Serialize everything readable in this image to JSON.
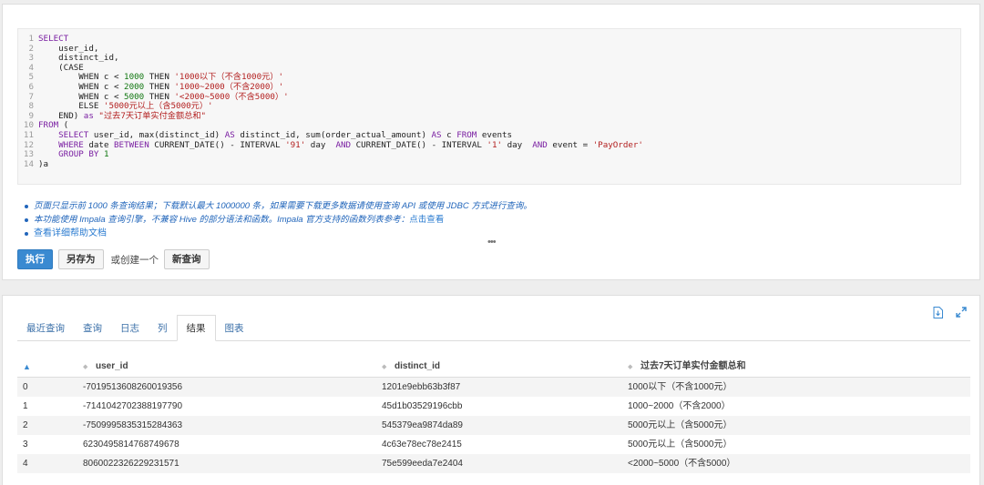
{
  "editor": {
    "lines": [
      {
        "n": "1",
        "parts": [
          {
            "t": "SELECT",
            "c": "kw"
          }
        ]
      },
      {
        "n": "2",
        "parts": [
          {
            "t": "    user_id,",
            "c": "plain"
          }
        ]
      },
      {
        "n": "3",
        "parts": [
          {
            "t": "    distinct_id,",
            "c": "plain"
          }
        ]
      },
      {
        "n": "4",
        "parts": [
          {
            "t": "    (CASE",
            "c": "plain"
          }
        ]
      },
      {
        "n": "5",
        "parts": [
          {
            "t": "        WHEN c < ",
            "c": "plain"
          },
          {
            "t": "1000",
            "c": "num"
          },
          {
            "t": " THEN ",
            "c": "plain"
          },
          {
            "t": "'1000以下（不含1000元）'",
            "c": "str"
          }
        ]
      },
      {
        "n": "6",
        "parts": [
          {
            "t": "        WHEN c < ",
            "c": "plain"
          },
          {
            "t": "2000",
            "c": "num"
          },
          {
            "t": " THEN ",
            "c": "plain"
          },
          {
            "t": "'1000~2000（不含2000）'",
            "c": "str"
          }
        ]
      },
      {
        "n": "7",
        "parts": [
          {
            "t": "        WHEN c < ",
            "c": "plain"
          },
          {
            "t": "5000",
            "c": "num"
          },
          {
            "t": " THEN ",
            "c": "plain"
          },
          {
            "t": "'<2000~5000（不含5000）'",
            "c": "str"
          }
        ]
      },
      {
        "n": "8",
        "parts": [
          {
            "t": "        ELSE ",
            "c": "plain"
          },
          {
            "t": "'5000元以上（含5000元）'",
            "c": "str"
          }
        ]
      },
      {
        "n": "9",
        "parts": [
          {
            "t": "    END) ",
            "c": "plain"
          },
          {
            "t": "as",
            "c": "kw"
          },
          {
            "t": " ",
            "c": "plain"
          },
          {
            "t": "\"过去7天订单实付金额总和\"",
            "c": "str"
          }
        ]
      },
      {
        "n": "10",
        "parts": [
          {
            "t": "FROM",
            "c": "kw"
          },
          {
            "t": " (",
            "c": "plain"
          }
        ]
      },
      {
        "n": "11",
        "parts": [
          {
            "t": "    ",
            "c": "plain"
          },
          {
            "t": "SELECT",
            "c": "kw"
          },
          {
            "t": " user_id, max(distinct_id) ",
            "c": "plain"
          },
          {
            "t": "AS",
            "c": "kw"
          },
          {
            "t": " distinct_id, sum(order_actual_amount) ",
            "c": "plain"
          },
          {
            "t": "AS",
            "c": "kw"
          },
          {
            "t": " c ",
            "c": "plain"
          },
          {
            "t": "FROM",
            "c": "kw"
          },
          {
            "t": " events",
            "c": "plain"
          }
        ]
      },
      {
        "n": "12",
        "parts": [
          {
            "t": "    ",
            "c": "plain"
          },
          {
            "t": "WHERE",
            "c": "kw"
          },
          {
            "t": " date ",
            "c": "plain"
          },
          {
            "t": "BETWEEN",
            "c": "kw"
          },
          {
            "t": " CURRENT_DATE() - INTERVAL ",
            "c": "plain"
          },
          {
            "t": "'91'",
            "c": "str"
          },
          {
            "t": " day  ",
            "c": "plain"
          },
          {
            "t": "AND",
            "c": "kw"
          },
          {
            "t": " CURRENT_DATE() - INTERVAL ",
            "c": "plain"
          },
          {
            "t": "'1'",
            "c": "str"
          },
          {
            "t": " day  ",
            "c": "plain"
          },
          {
            "t": "AND",
            "c": "kw"
          },
          {
            "t": " event = ",
            "c": "plain"
          },
          {
            "t": "'PayOrder'",
            "c": "str"
          }
        ]
      },
      {
        "n": "13",
        "parts": [
          {
            "t": "    ",
            "c": "plain"
          },
          {
            "t": "GROUP BY",
            "c": "kw"
          },
          {
            "t": " ",
            "c": "plain"
          },
          {
            "t": "1",
            "c": "num"
          }
        ]
      },
      {
        "n": "14",
        "parts": [
          {
            "t": ")a",
            "c": "plain"
          }
        ]
      }
    ]
  },
  "notes": {
    "line1": "页面只显示前 1000 条查询结果；下载默认最大 1000000 条，如果需要下载更多数据请使用查询 API 或使用 JDBC 方式进行查询。",
    "line2": "本功能使用 Impala 查询引擎，不兼容 Hive 的部分语法和函数。Impala 官方支持的函数列表参考：",
    "line2_link": "点击查看",
    "line3": "查看详细帮助文档"
  },
  "ellipsis": "•••",
  "actions": {
    "run": "执行",
    "save_as": "另存为",
    "or_create": "或创建一个",
    "new_query": "新查询"
  },
  "tabs": [
    {
      "label": "最近查询",
      "active": false
    },
    {
      "label": "查询",
      "active": false
    },
    {
      "label": "日志",
      "active": false
    },
    {
      "label": "列",
      "active": false
    },
    {
      "label": "结果",
      "active": true
    },
    {
      "label": "图表",
      "active": false
    }
  ],
  "table": {
    "columns": [
      "user_id",
      "distinct_id",
      "过去7天订单实付金额总和"
    ],
    "rows": [
      [
        "0",
        "-7019513608260019356",
        "1201e9ebb63b3f87",
        "1000以下（不含1000元）"
      ],
      [
        "1",
        "-7141042702388197790",
        "45d1b03529196cbb",
        "1000~2000（不含2000）"
      ],
      [
        "2",
        "-7509995835315284363",
        "545379ea9874da89",
        "5000元以上（含5000元）"
      ],
      [
        "3",
        "6230495814768749678",
        "4c63e78ec78e2415",
        "5000元以上（含5000元）"
      ],
      [
        "4",
        "8060022326229231571",
        "75e599eeda7e2404",
        "<2000~5000（不含5000）"
      ]
    ]
  },
  "icons": {
    "download": "download-icon",
    "expand": "expand-icon"
  }
}
